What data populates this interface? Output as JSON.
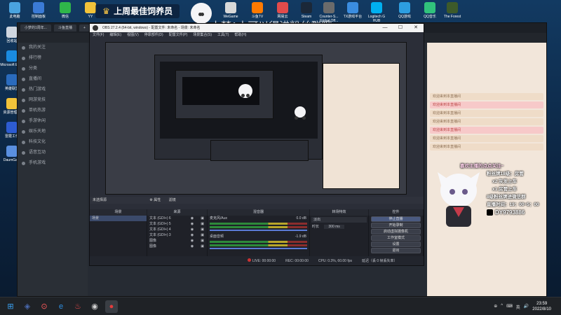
{
  "banner": {
    "crown": "♛",
    "text": "上周最佳饲养员"
  },
  "scroll_title": "小梦1小可以得进粉丝群哦~",
  "desktop_icons": [
    {
      "label": "此电脑",
      "color": "#4aa3df"
    },
    {
      "label": "控制面板",
      "color": "#3b7bd6"
    },
    {
      "label": "微信",
      "color": "#2fb64a"
    },
    {
      "label": "YY",
      "color": "#f2c33a"
    },
    {
      "label": "WeGame",
      "color": "#d8d8d8"
    },
    {
      "label": "斗鱼TV",
      "color": "#ff7a00"
    },
    {
      "label": "网易云",
      "color": "#e24b4b"
    },
    {
      "label": "Steam",
      "color": "#1b2838"
    },
    {
      "label": "Counter-S... Global Off...",
      "color": "#6b6b6b"
    },
    {
      "label": "TX游戏平台",
      "color": "#3b8de0"
    },
    {
      "label": "Logitech G HUB",
      "color": "#00b0f0"
    },
    {
      "label": "QQ游戏",
      "color": "#2d9ee0"
    },
    {
      "label": "QQ音乐",
      "color": "#31c27c"
    },
    {
      "label": "The Forest",
      "color": "#3d5a2a"
    }
  ],
  "left_icons": [
    {
      "label": "回收站",
      "color": "#cfd6e0"
    },
    {
      "label": "Microsoft Edge",
      "color": "#1a8be0"
    },
    {
      "label": "英雄联盟",
      "color": "#2a6bbd"
    },
    {
      "label": "资源管理器",
      "color": "#f2c33a"
    },
    {
      "label": "雷霆工作",
      "color": "#2e5cd1"
    },
    {
      "label": "DaumGa...",
      "color": "#5a8fe0"
    }
  ],
  "browser": {
    "tabs": [
      "小梦的1周年...",
      "斗鱼直播",
      "+"
    ],
    "sidebar": [
      "我的关注",
      "排行榜",
      "分类",
      "直播间",
      "热门游戏",
      "网游竞技",
      "单机热游",
      "手游休闲",
      "娱乐天地",
      "科技文化",
      "语音互动",
      "手机游戏"
    ],
    "chat": [
      {
        "text": "欢迎来到本直播间",
        "highlight": false
      },
      {
        "text": "欢迎来到本直播间",
        "highlight": true
      },
      {
        "text": "欢迎来到本直播间",
        "highlight": false
      },
      {
        "text": "欢迎来到本直播间",
        "highlight": false
      },
      {
        "text": "欢迎来到本直播间",
        "highlight": true
      },
      {
        "text": "欢迎来到本直播间",
        "highlight": false
      },
      {
        "text": "欢迎来到本直播间",
        "highlight": false
      }
    ]
  },
  "obs": {
    "title": "OBS 27.2.4 (64-bit, windows) - 配置文件: 未命名 - 场景: 未命名",
    "menu": [
      "文件(F)",
      "编辑(E)",
      "视图(V)",
      "停靠部件(D)",
      "配置文件(P)",
      "场景集合(S)",
      "工具(T)",
      "帮助(H)"
    ],
    "win_min": "—",
    "win_max": "☐",
    "win_close": "✕",
    "scene_bar": "未选择源",
    "scene_props": "⚙ 属性",
    "scene_filter": "滤镜",
    "docks": [
      "场景",
      "来源",
      "混音器",
      "转场特效",
      "控件"
    ],
    "scenes": [
      "场景"
    ],
    "sources": [
      "文本 (GDI+) 6",
      "文本 (GDI+) 5",
      "文本 (GDI+) 4",
      "文本 (GDI+) 3",
      "图像",
      "图像"
    ],
    "mixer": [
      {
        "name": "麦克风/Aux",
        "db": "0.0 dB"
      },
      {
        "name": "桌面音频",
        "db": "-1.9 dB"
      }
    ],
    "transition": {
      "name": "淡出",
      "duration_label": "时长",
      "duration": "300 ms"
    },
    "controls": [
      "停止直播",
      "开始录制",
      "启动虚拟摄像机",
      "工作室模式",
      "设置",
      "退出"
    ],
    "status": {
      "live": "LIVE: 00:00:00",
      "rec": "REC: 00:00:00",
      "cpu": "CPU: 0.3%, 60.00 fps",
      "dropped": "延迟（丢 0 帧丢失率）"
    }
  },
  "overlay": {
    "l1": "喜欢主播的点点关注~",
    "l2": "粉丝牌18级：房管",
    "l3": "x2 灰发上车",
    "l4": "x1 房管上车",
    "l5": "8级粉丝牌进微信群",
    "l6": "直播时间：19：00~5：00",
    "l7": "DY9793886"
  },
  "taskbar": {
    "apps": [
      "⊞",
      "◈",
      "⊙",
      "e",
      "♨",
      "◉",
      "●"
    ],
    "tray_icons": [
      "⊕",
      "^",
      "⌨",
      "英",
      "🔊"
    ],
    "time": "23:59",
    "date": "2022/8/10"
  }
}
